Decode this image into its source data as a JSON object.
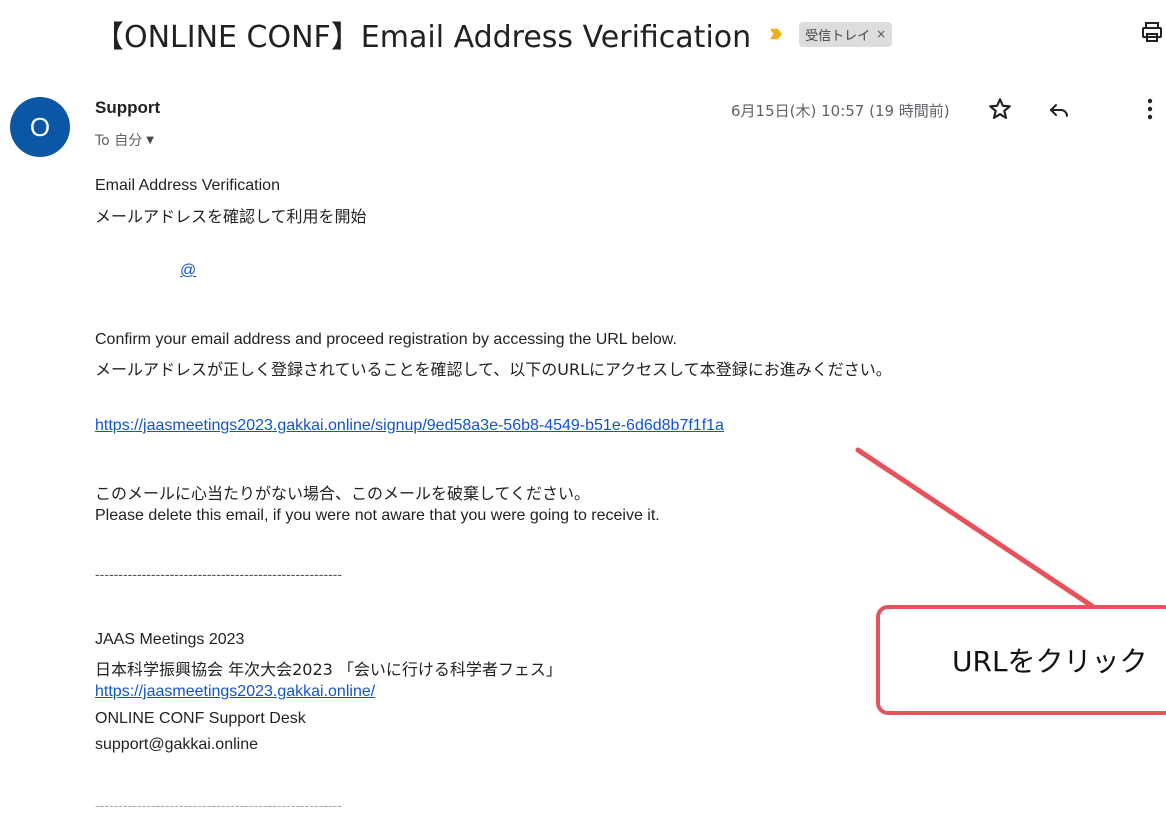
{
  "email": {
    "subject": "【ONLINE CONF】Email Address Verification",
    "label": "受信トレイ",
    "label_close": "×",
    "sender_initial": "O",
    "sender_name": "Support",
    "recipient": "To 自分",
    "date": "6月15日(木) 10:57 (19 時間前)",
    "icons": {
      "importance": "importance-marker-icon",
      "print": "print-icon",
      "star": "star-icon",
      "reply": "reply-icon",
      "more": "more-vert-icon",
      "recipient_dropdown": "chevron-down-icon"
    }
  },
  "body": {
    "heading_en": "Email Address Verification",
    "heading_ja": "メールアドレスを確認して利用を開始",
    "masked_address": "@",
    "instruction_en": "Confirm your email address and proceed registration by accessing the URL below.",
    "instruction_ja": "メールアドレスが正しく登録されていることを確認して、以下のURLにアクセスして本登録にお進みください。",
    "verification_url": "https://jaasmeetings2023.gakkai.online/signup/9ed58a3e-56b8-4549-b51e-6d6d8b7f1f1a",
    "ignore_ja": "このメールに心当たりがない場合、このメールを破棄してください。",
    "ignore_en": "Please delete this email, if you were not aware that you were going to receive it.",
    "separator": "-----------------------------------------------------",
    "signature": {
      "event_name": "JAAS Meetings 2023",
      "event_name_ja": "日本科学振興協会 年次大会2023 「会いに行ける科学者フェス」",
      "event_url": "https://jaasmeetings2023.gakkai.online/",
      "desk": "ONLINE CONF Support Desk",
      "email": "support@gakkai.online"
    }
  },
  "annotation": {
    "callout_text": "URLをクリック",
    "colors": {
      "accent": "#e5545c",
      "avatar": "#0b57a5",
      "link": "#1155cc",
      "importance": "#f2b01e"
    }
  }
}
